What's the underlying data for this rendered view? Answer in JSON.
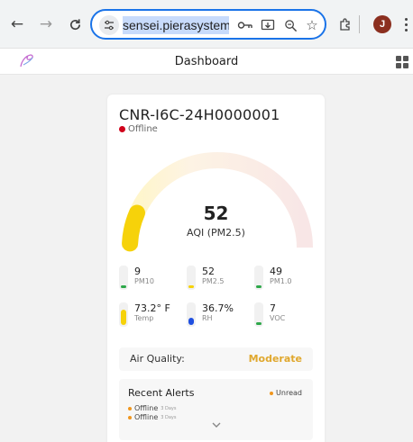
{
  "browser": {
    "url": "sensei.pierasystems.com/",
    "avatar_initial": "J"
  },
  "app": {
    "title": "Dashboard"
  },
  "device": {
    "name": "CNR-I6C-24H0000001",
    "status": "Offline",
    "status_color": "#d0021b"
  },
  "aqi": {
    "value": "52",
    "label": "AQI (PM2.5)",
    "fraction": 0.26,
    "color": "#f6d20a"
  },
  "metrics": [
    {
      "value": "9",
      "label": "PM10",
      "color": "#2ea84a",
      "fraction": 0.15
    },
    {
      "value": "52",
      "label": "PM2.5",
      "color": "#f6d20a",
      "fraction": 0.15
    },
    {
      "value": "49",
      "label": "PM1.0",
      "color": "#2ea84a",
      "fraction": 0.15
    },
    {
      "value": "73.2° F",
      "label": "Temp",
      "color": "#f6d20a",
      "fraction": 0.75
    },
    {
      "value": "36.7%",
      "label": "RH",
      "color": "#1f4fe0",
      "fraction": 0.35
    },
    {
      "value": "7",
      "label": "VOC",
      "color": "#2ea84a",
      "fraction": 0.15
    }
  ],
  "air_quality": {
    "label": "Air Quality:",
    "value": "Moderate",
    "color": "#e0a82e"
  },
  "alerts": {
    "title": "Recent Alerts",
    "unread_label": "Unread",
    "items": [
      {
        "text": "Offline",
        "age": "3 Days"
      },
      {
        "text": "Offline",
        "age": "3 Days"
      }
    ]
  },
  "colors": {
    "accent_blue": "#1a73e8",
    "dot_orange": "#f0961e"
  }
}
